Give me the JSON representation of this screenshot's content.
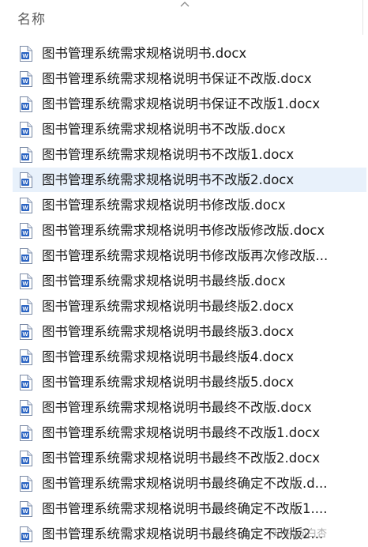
{
  "header": {
    "name_column": "名称",
    "sort_icon": "chevron-up-icon"
  },
  "files": [
    {
      "name": "图书管理系统需求规格说明书.docx",
      "icon": "word-doc-icon"
    },
    {
      "name": "图书管理系统需求规格说明书保证不改版.docx",
      "icon": "word-doc-icon"
    },
    {
      "name": "图书管理系统需求规格说明书保证不改版1.docx",
      "icon": "word-doc-icon"
    },
    {
      "name": "图书管理系统需求规格说明书不改版.docx",
      "icon": "word-doc-icon"
    },
    {
      "name": "图书管理系统需求规格说明书不改版1.docx",
      "icon": "word-doc-icon"
    },
    {
      "name": "图书管理系统需求规格说明书不改版2.docx",
      "icon": "word-doc-icon",
      "selected": true
    },
    {
      "name": "图书管理系统需求规格说明书修改版.docx",
      "icon": "word-doc-icon"
    },
    {
      "name": "图书管理系统需求规格说明书修改版修改版.docx",
      "icon": "word-doc-icon"
    },
    {
      "name": "图书管理系统需求规格说明书修改版再次修改版...",
      "icon": "word-doc-icon"
    },
    {
      "name": "图书管理系统需求规格说明书最终版.docx",
      "icon": "word-doc-icon"
    },
    {
      "name": "图书管理系统需求规格说明书最终版2.docx",
      "icon": "word-doc-icon"
    },
    {
      "name": "图书管理系统需求规格说明书最终版3.docx",
      "icon": "word-doc-icon"
    },
    {
      "name": "图书管理系统需求规格说明书最终版4.docx",
      "icon": "word-doc-icon"
    },
    {
      "name": "图书管理系统需求规格说明书最终版5.docx",
      "icon": "word-doc-icon"
    },
    {
      "name": "图书管理系统需求规格说明书最终不改版.docx",
      "icon": "word-doc-icon"
    },
    {
      "name": "图书管理系统需求规格说明书最终不改版1.docx",
      "icon": "word-doc-icon"
    },
    {
      "name": "图书管理系统需求规格说明书最终不改版2.docx",
      "icon": "word-doc-icon"
    },
    {
      "name": "图书管理系统需求规格说明书最终确定不改版.d...",
      "icon": "word-doc-icon"
    },
    {
      "name": "图书管理系统需求规格说明书最终确定不改版1....",
      "icon": "word-doc-icon"
    },
    {
      "name": "图书管理系统需求规格说明书最终确定不改版2...",
      "icon": "word-doc-icon"
    }
  ],
  "watermark": "知乎 @白杏",
  "colors": {
    "selection": "#e8f1fb",
    "word_icon": "#2b64c2",
    "header_text": "#5a5a5a"
  }
}
